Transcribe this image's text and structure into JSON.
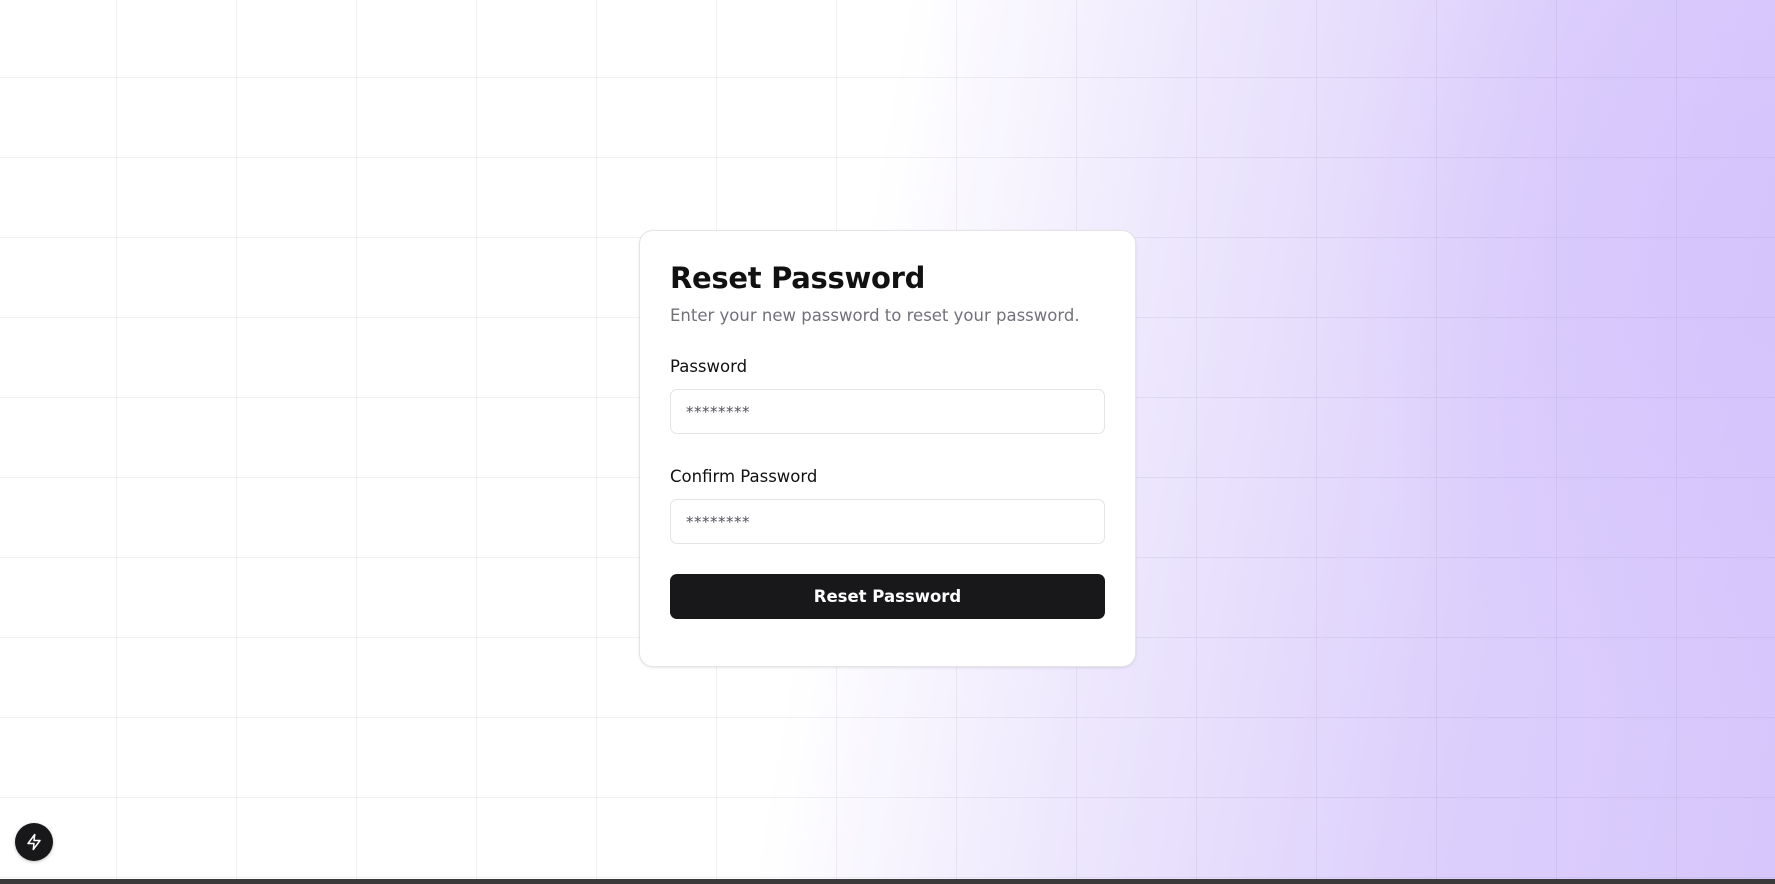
{
  "card": {
    "title": "Reset Password",
    "subtitle": "Enter your new password to reset your password."
  },
  "form": {
    "password": {
      "label": "Password",
      "placeholder": "********",
      "value": ""
    },
    "confirm_password": {
      "label": "Confirm Password",
      "placeholder": "********",
      "value": ""
    },
    "submit_label": "Reset Password"
  },
  "floating_button": {
    "icon": "lightning-bolt-icon"
  },
  "colors": {
    "accent_gradient": "#d6c6fb",
    "button_bg": "#18181b",
    "button_text": "#ffffff",
    "subtitle_text": "#71717a",
    "card_border": "#e4e4e7"
  }
}
